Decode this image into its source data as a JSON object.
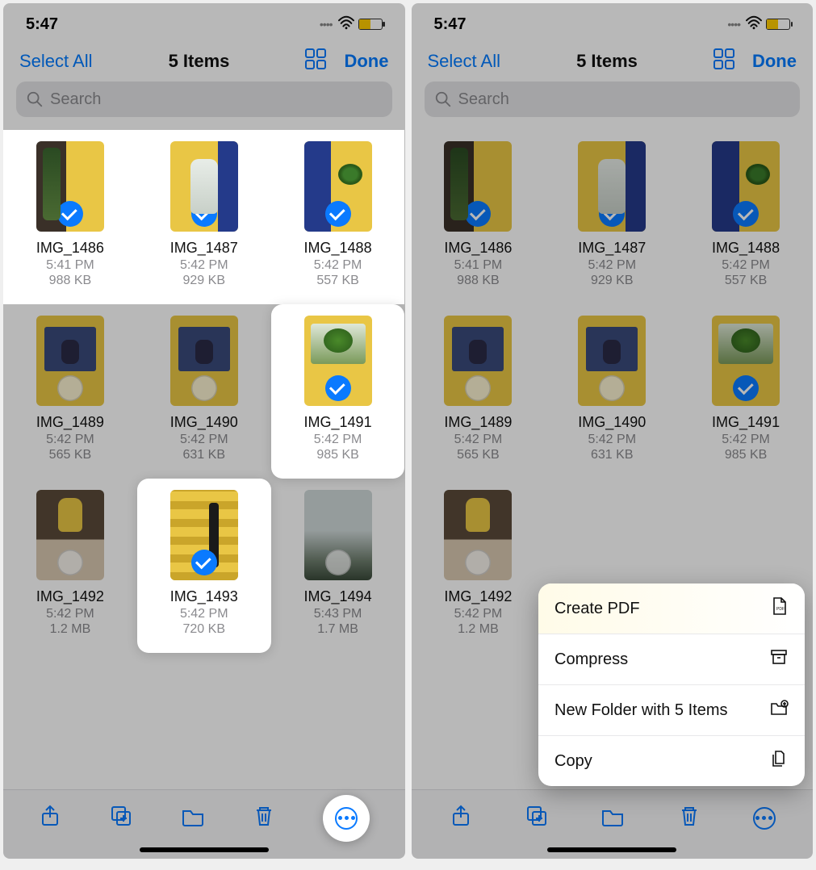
{
  "status": {
    "time": "5:47"
  },
  "nav": {
    "select_all": "Select All",
    "title": "5 Items",
    "done": "Done"
  },
  "search": {
    "placeholder": "Search"
  },
  "items": [
    {
      "name": "IMG_1486",
      "time": "5:41 PM",
      "size": "988 KB",
      "selected": true,
      "thumb": "t1486"
    },
    {
      "name": "IMG_1487",
      "time": "5:42 PM",
      "size": "929 KB",
      "selected": true,
      "thumb": "t1487"
    },
    {
      "name": "IMG_1488",
      "time": "5:42 PM",
      "size": "557 KB",
      "selected": true,
      "thumb": "t1488"
    },
    {
      "name": "IMG_1489",
      "time": "5:42 PM",
      "size": "565 KB",
      "selected": false,
      "thumb": "t1489"
    },
    {
      "name": "IMG_1490",
      "time": "5:42 PM",
      "size": "631 KB",
      "selected": false,
      "thumb": "t1490"
    },
    {
      "name": "IMG_1491",
      "time": "5:42 PM",
      "size": "985 KB",
      "selected": true,
      "thumb": "t1491"
    },
    {
      "name": "IMG_1492",
      "time": "5:42 PM",
      "size": "1.2 MB",
      "selected": false,
      "thumb": "t1492"
    },
    {
      "name": "IMG_1493",
      "time": "5:42 PM",
      "size": "720 KB",
      "selected": true,
      "thumb": "t1493"
    },
    {
      "name": "IMG_1494",
      "time": "5:43 PM",
      "size": "1.7 MB",
      "selected": false,
      "thumb": "t1494"
    }
  ],
  "left_highlights": {
    "row1_full": true,
    "individual": [
      5,
      7
    ]
  },
  "menu": {
    "create_pdf": "Create PDF",
    "compress": "Compress",
    "new_folder": "New Folder with 5 Items",
    "copy": "Copy"
  }
}
